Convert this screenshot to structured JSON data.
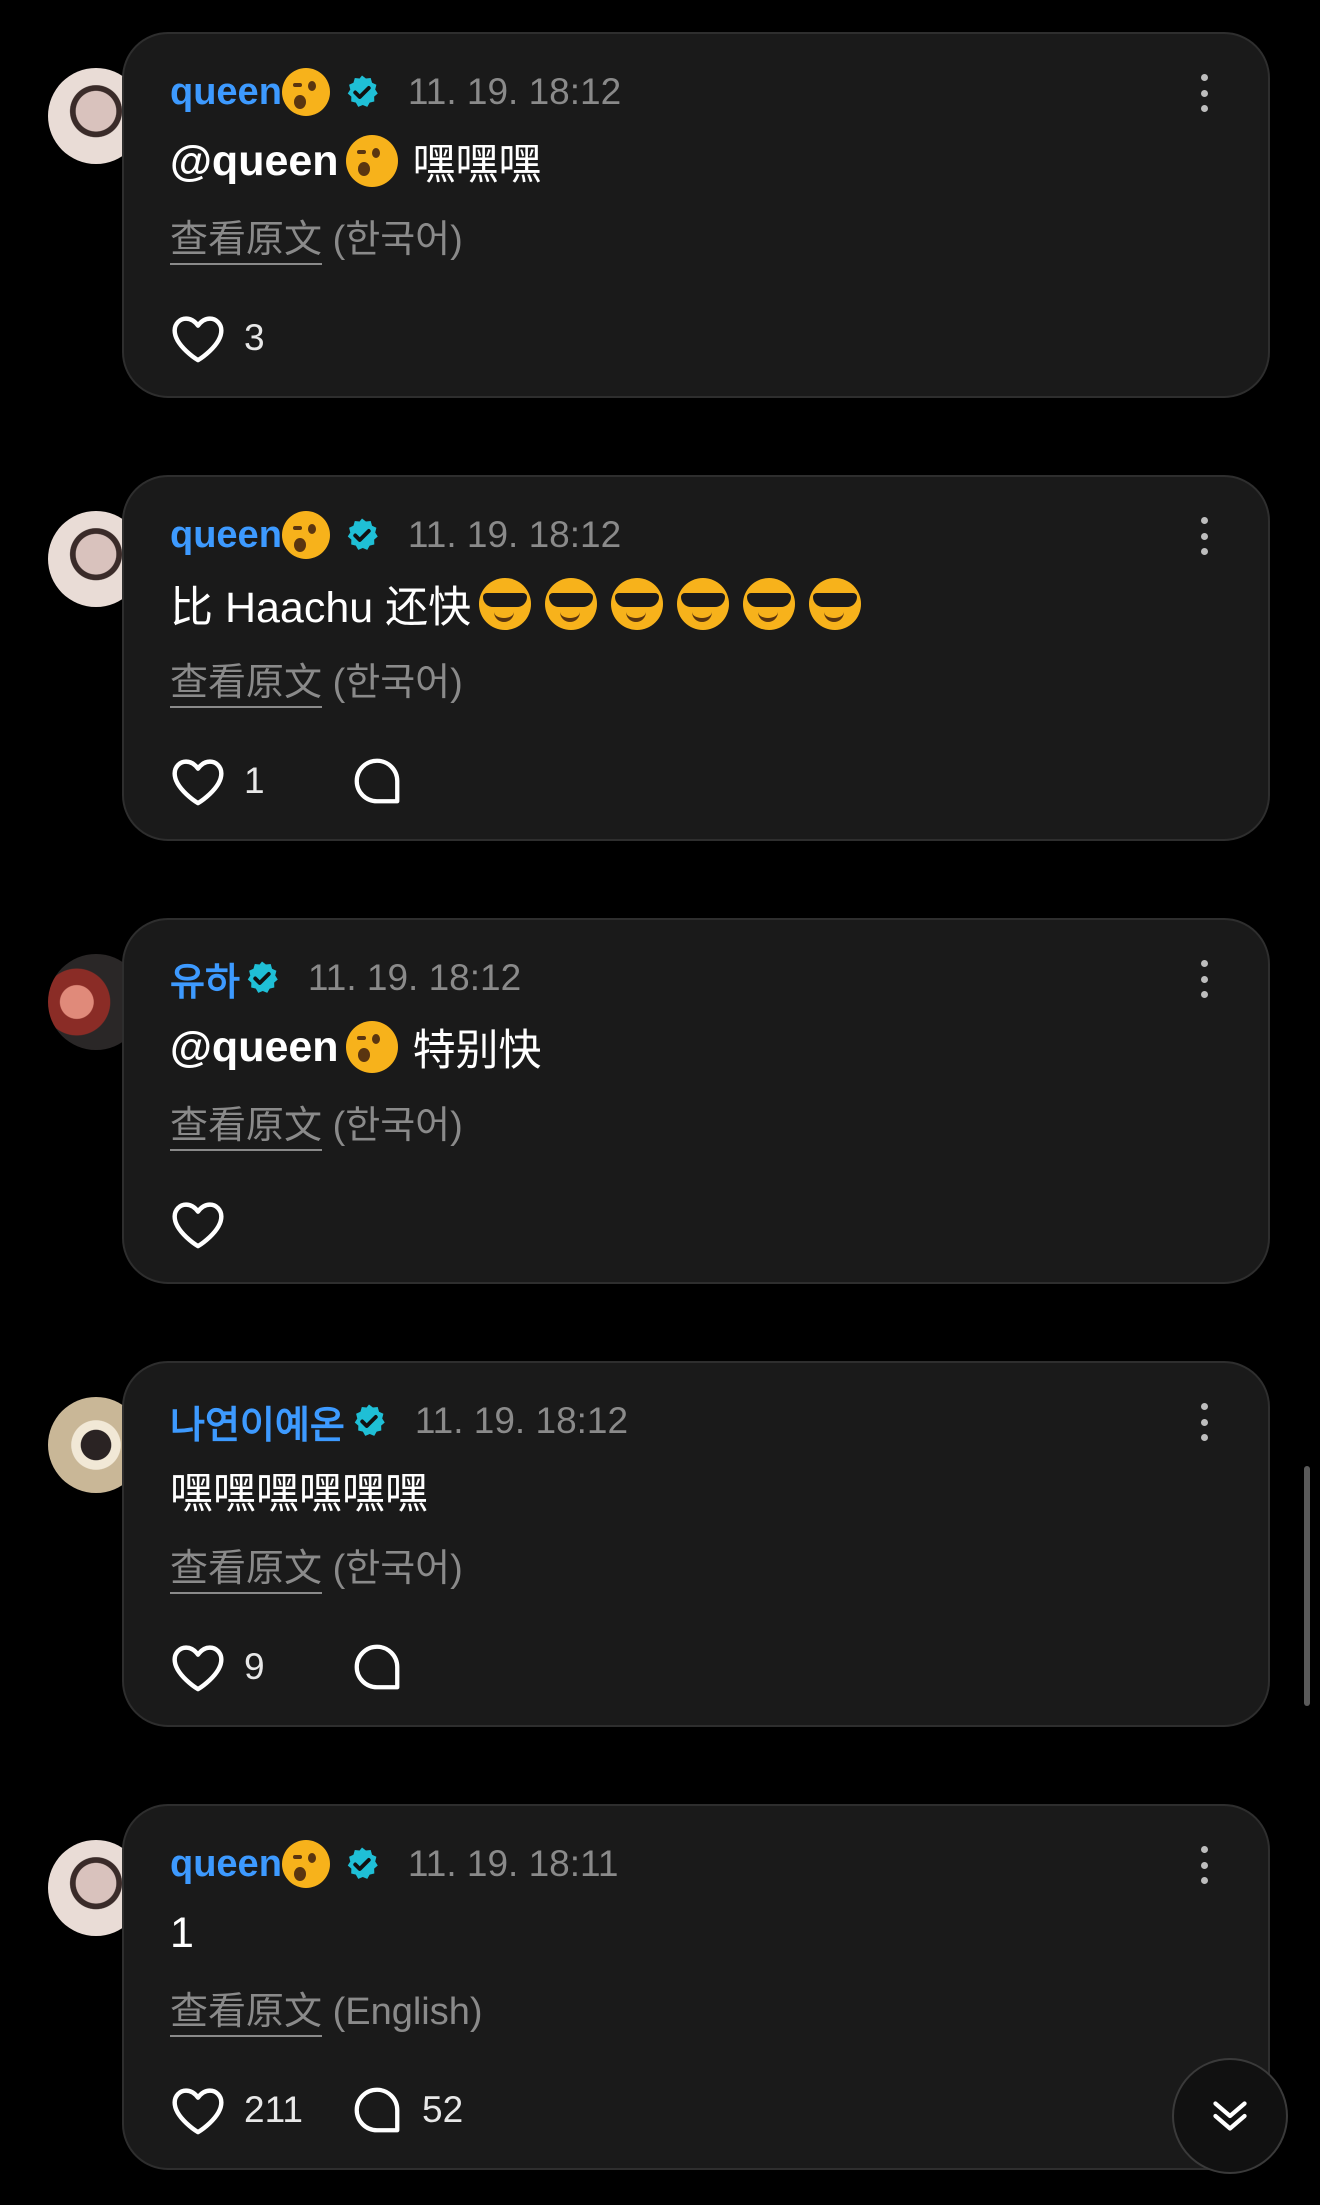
{
  "comments": [
    {
      "username": "queen",
      "name_emoji": "winking-face",
      "timestamp": "11. 19. 18:12",
      "mention": "@queen",
      "text": "嘿嘿嘿",
      "translate_link": "查看原文",
      "translate_lang": "(한국어)",
      "likes": "3",
      "replies": ""
    },
    {
      "username": "queen",
      "name_emoji": "winking-face",
      "timestamp": "11. 19. 18:12",
      "mention": "",
      "text": "比 Haachu 还快",
      "text_emoji": "smiling-face-with-sunglasses",
      "text_emoji_count": 6,
      "translate_link": "查看原文",
      "translate_lang": "(한국어)",
      "likes": "1",
      "replies": ""
    },
    {
      "username": "유하",
      "timestamp": "11. 19. 18:12",
      "mention": "@queen",
      "mention_emoji": "winking-face",
      "text": "特别快",
      "translate_link": "查看原文",
      "translate_lang": "(한국어)",
      "likes": "",
      "replies": ""
    },
    {
      "username": "나연이예온",
      "timestamp": "11. 19. 18:12",
      "mention": "",
      "text": "嘿嘿嘿嘿嘿嘿",
      "translate_link": "查看原文",
      "translate_lang": "(한국어)",
      "likes": "9",
      "replies": ""
    },
    {
      "username": "queen",
      "name_emoji": "winking-face",
      "timestamp": "11. 19. 18:11",
      "mention": "",
      "text": "1",
      "translate_link": "查看原文",
      "translate_lang": "(English)",
      "likes": "211",
      "replies": "52"
    }
  ],
  "colors": {
    "username": "#3d9aff",
    "verified_badge": "#1fbfd6",
    "card_background": "#1a1a1a",
    "muted_text": "#8a8a8a"
  },
  "icons": {
    "verified": "verified-badge-icon",
    "more": "more-vertical-icon",
    "like": "heart-outline-icon",
    "reply": "comment-bubble-icon",
    "scroll_down": "double-chevron-down-icon"
  }
}
